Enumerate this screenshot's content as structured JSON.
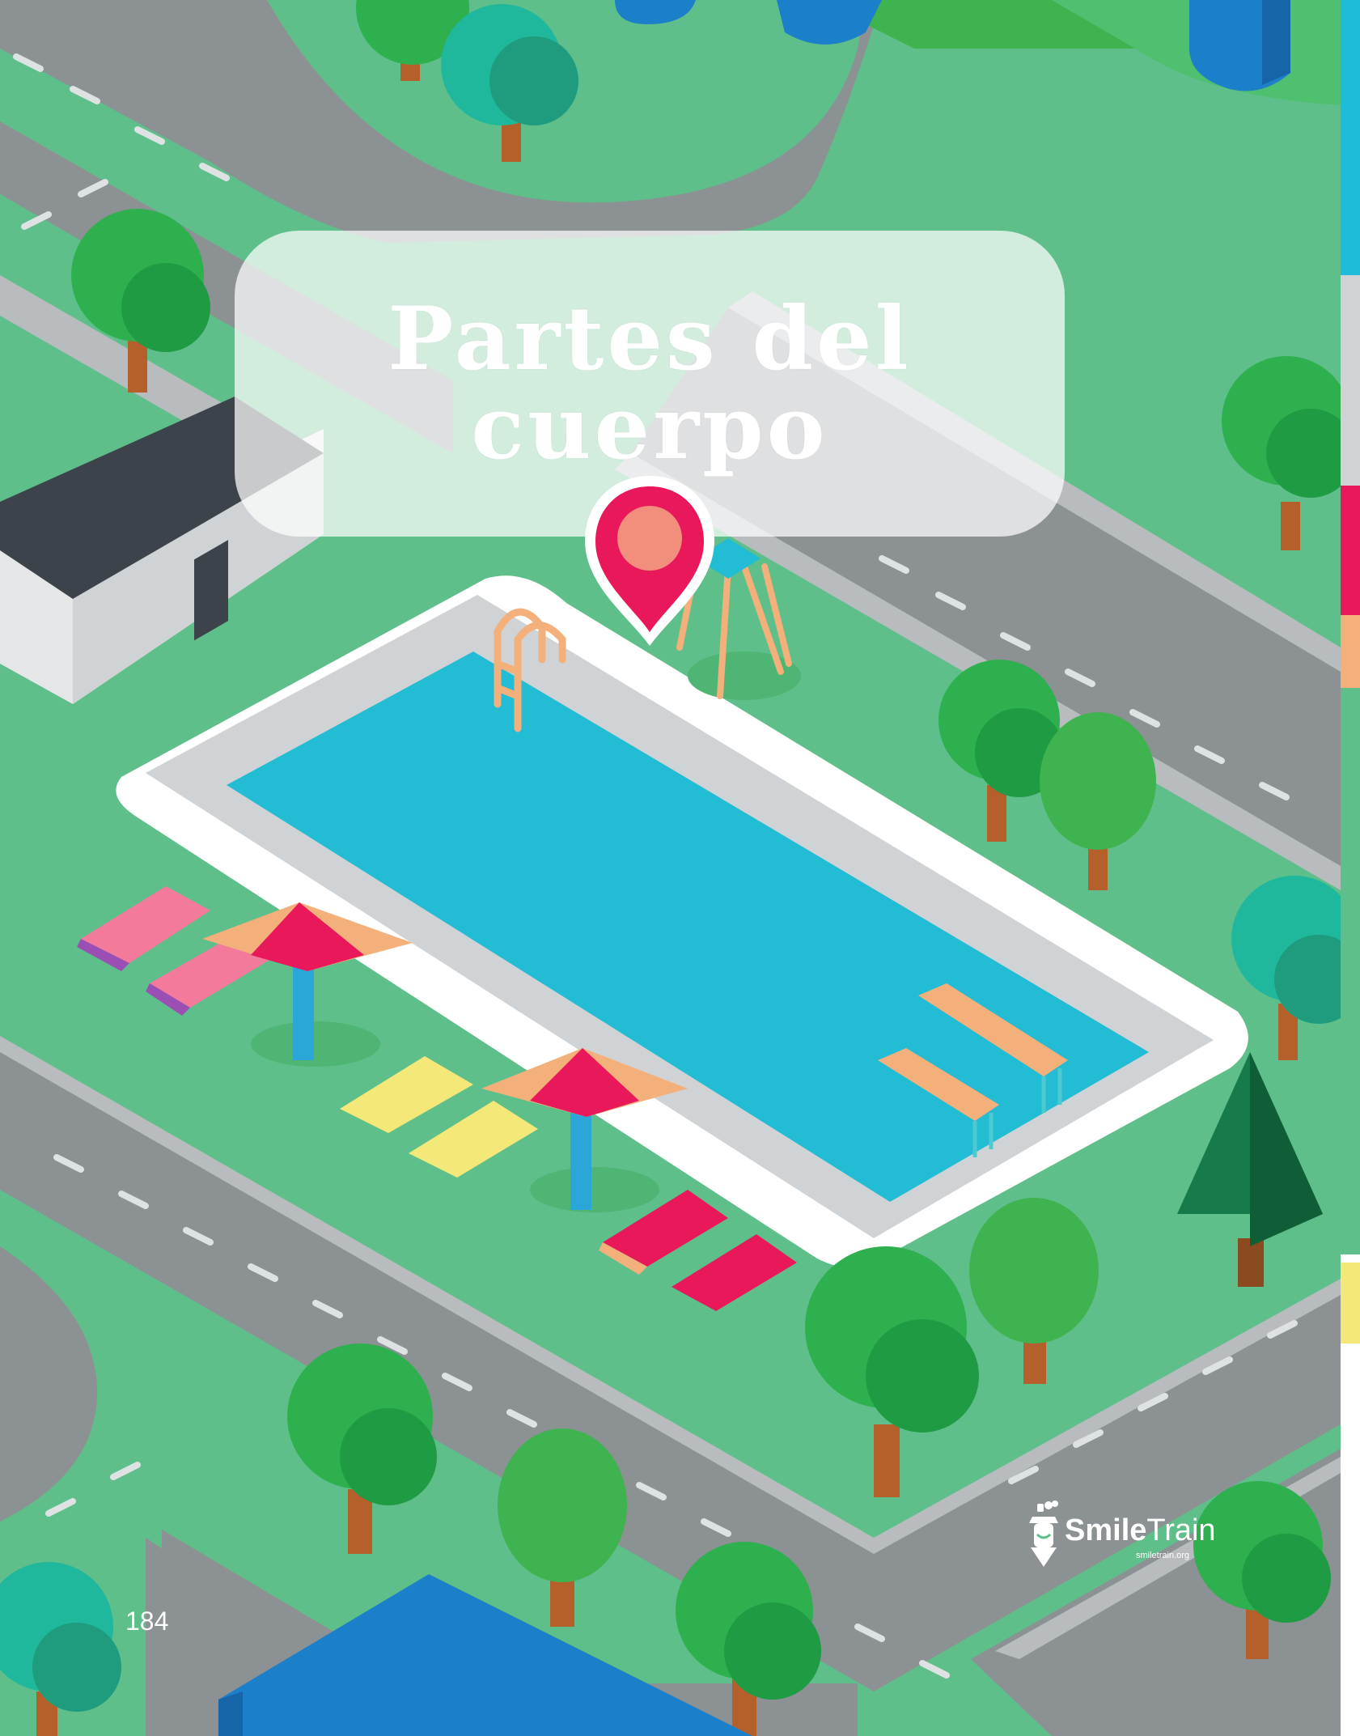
{
  "title": {
    "line1": "Partes del",
    "line2": "cuerpo"
  },
  "page_number": "184",
  "logo": {
    "name_bold": "Smile",
    "name_light": "Train",
    "url": "smiletrain.org"
  },
  "colors": {
    "grass": "#5fbf8a",
    "road": "#8c9193",
    "pool_water": "#22bcd4",
    "pin": "#e8185b",
    "tree_green": "#2eb04f"
  },
  "icons": [
    "location-pin-icon",
    "smile-train-logo-icon"
  ]
}
